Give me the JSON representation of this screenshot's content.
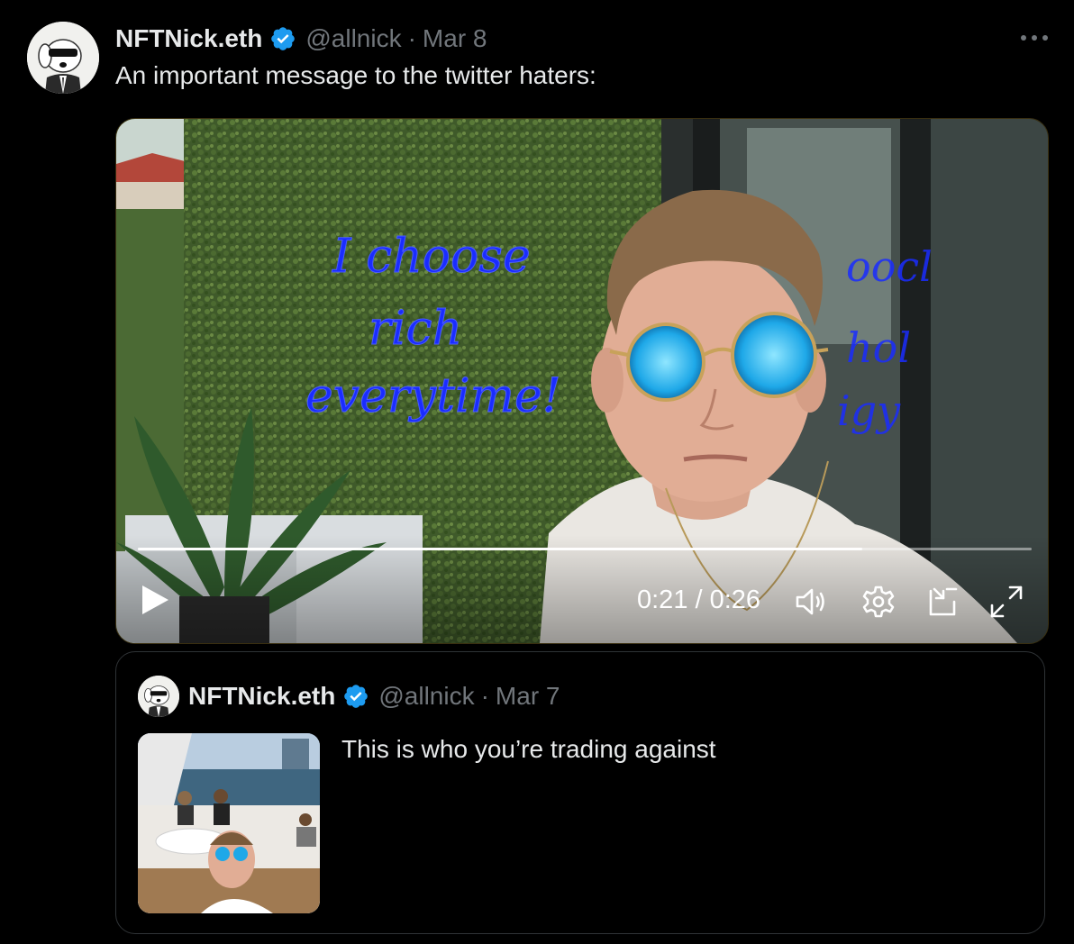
{
  "tweet": {
    "display_name": "NFTNick.eth",
    "handle": "@allnick",
    "separator": "·",
    "time": "Mar 8",
    "text": "An important message to the twitter haters:",
    "more_icon": "more-horizontal-icon"
  },
  "video": {
    "time_label": "0:21 / 0:26",
    "progress": 0.81,
    "neon_text": "I choose rich everytime!",
    "icons": [
      "play-icon",
      "volume-icon",
      "settings-icon",
      "pip-icon",
      "fullscreen-icon"
    ]
  },
  "quote": {
    "display_name": "NFTNick.eth",
    "handle": "@allnick",
    "separator": "·",
    "time": "Mar 7",
    "text": "This is who you’re trading against"
  },
  "colors": {
    "background": "#000000",
    "text_primary": "#e7e9ea",
    "text_secondary": "#71767b",
    "verified_blue": "#1d9bf0",
    "border": "#2f3336"
  }
}
